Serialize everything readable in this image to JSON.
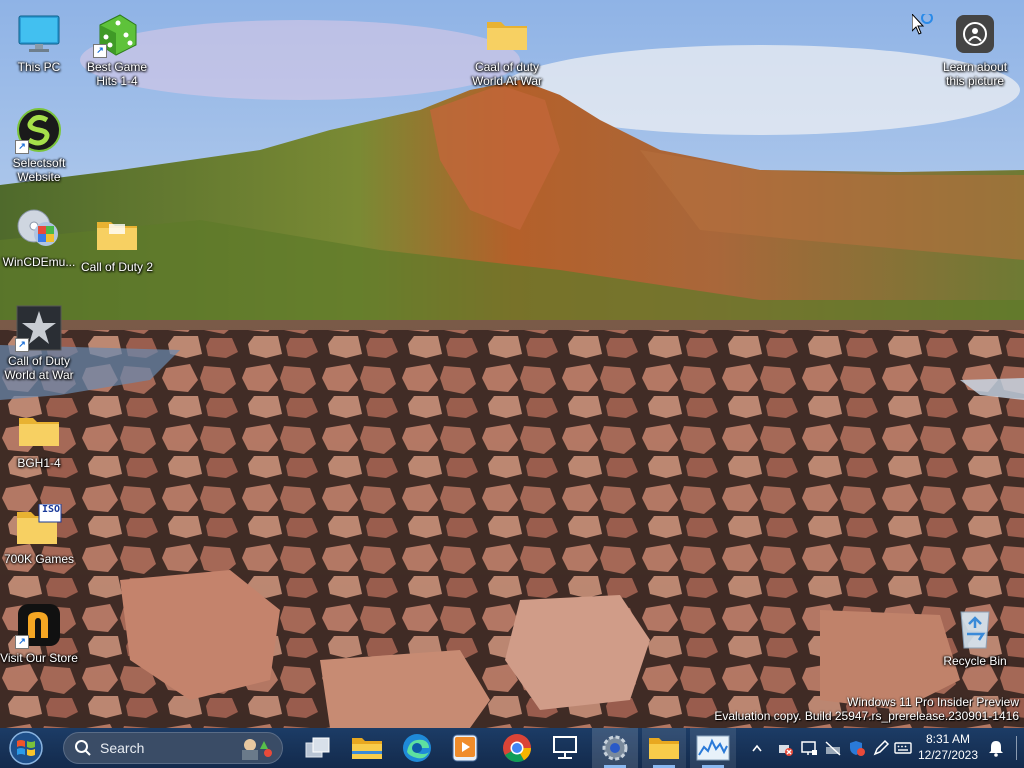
{
  "desktop": {
    "icons": [
      {
        "id": "this-pc",
        "label": "This PC"
      },
      {
        "id": "best-game-hits",
        "label": "Best Game Hits 1-4"
      },
      {
        "id": "caal-of-duty",
        "label": "Caal of duty World At War"
      },
      {
        "id": "learn-about-picture",
        "label": "Learn about this picture"
      },
      {
        "id": "selectsoft",
        "label": "Selectsoft Website"
      },
      {
        "id": "wincdemu",
        "label": "WinCDEmu..."
      },
      {
        "id": "call-of-duty-2",
        "label": "Call of Duty 2"
      },
      {
        "id": "call-of-duty-waw",
        "label": "Call of Duty World at War"
      },
      {
        "id": "bgh",
        "label": "BGH1-4"
      },
      {
        "id": "700k-games",
        "label": "700K Games"
      },
      {
        "id": "visit-our-store",
        "label": "Visit Our Store"
      },
      {
        "id": "recycle-bin",
        "label": "Recycle Bin"
      }
    ],
    "iso_badge": "ISO"
  },
  "watermark": {
    "line1": "Windows 11 Pro Insider Preview",
    "line2": "Evaluation copy. Build 25947.rs_prerelease.230901-1416"
  },
  "taskbar": {
    "search_label": "Search",
    "pinned": [
      {
        "name": "task-view-icon"
      },
      {
        "name": "file-explorer-icon"
      },
      {
        "name": "edge-icon"
      },
      {
        "name": "media-player-icon"
      },
      {
        "name": "chrome-icon"
      },
      {
        "name": "remote-desktop-icon"
      },
      {
        "name": "settings-icon"
      },
      {
        "name": "folder-icon"
      },
      {
        "name": "resource-monitor-icon"
      }
    ],
    "clock": {
      "time": "8:31 AM",
      "date": "12/27/2023"
    }
  },
  "colors": {
    "taskbar": "#16325a",
    "sky": "#9ec2ea"
  }
}
